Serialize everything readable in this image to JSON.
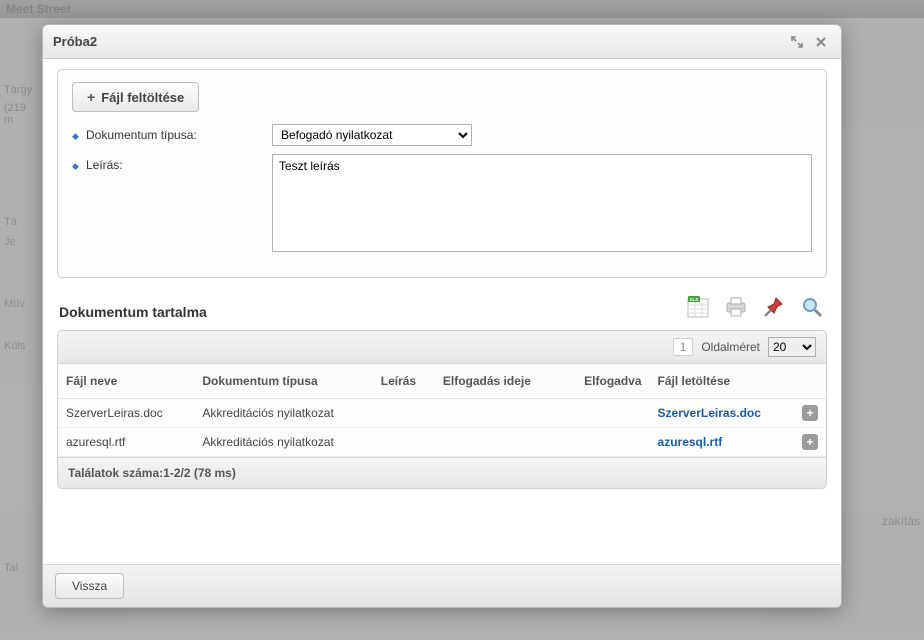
{
  "background": {
    "app_title": "Meet Street",
    "left_fragment_1": "Tárgy",
    "left_fragment_2": "(219 m",
    "left_fragment_3": "Tá",
    "left_fragment_4": "Je",
    "left_label_1": "Műv",
    "left_label_2": "Küls",
    "right_fragment": "zakítás",
    "bottom_left": "Tal"
  },
  "modal": {
    "title": "Próba2",
    "upload_button": "Fájl feltöltése",
    "labels": {
      "doc_type": "Dokumentum típusa:",
      "description": "Leírás:"
    },
    "doc_type_selected": "Befogadó nyilatkozat",
    "description_value": "Teszt leírás",
    "section_title": "Dokumentum tartalma",
    "pager": {
      "page_label": "1",
      "page_size_label": "Oldalméret",
      "page_size_value": "20"
    },
    "columns": {
      "filename": "Fájl neve",
      "doc_type": "Dokumentum típusa",
      "desc": "Leírás",
      "accepted_at": "Elfogadás ideje",
      "accepted": "Elfogadva",
      "download": "Fájl letöltése"
    },
    "rows": [
      {
        "filename": "SzerverLeiras.doc",
        "doc_type": "Akkreditációs nyilatkozat",
        "desc": "",
        "accepted_at": "",
        "accepted": "",
        "download": "SzerverLeiras.doc"
      },
      {
        "filename": "azuresql.rtf",
        "doc_type": "Akkreditációs nyilatkozat",
        "desc": "",
        "accepted_at": "",
        "accepted": "",
        "download": "azuresql.rtf"
      }
    ],
    "result_count": "Találatok száma:1-2/2 (78 ms)",
    "back_button": "Vissza"
  }
}
